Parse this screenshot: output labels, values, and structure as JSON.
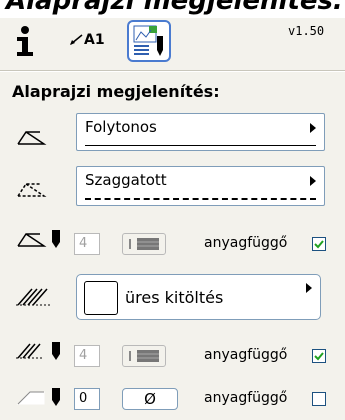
{
  "header": {
    "banner_title": "Alaprajzi megjelenítés:",
    "version": "v1.50",
    "info_icon": "info-icon",
    "arrow_label": "A1",
    "pen_button_icon": "pen-settings-icon"
  },
  "section": {
    "title": "Alaprajzi megjelenítés:"
  },
  "rows": {
    "solid_line": {
      "label": "Folytonos",
      "icon": "contour-line-icon"
    },
    "dashed_line": {
      "label": "Szaggatott",
      "icon": "dashed-line-icon"
    },
    "contour_pen": {
      "pen_value": "4",
      "checkbox_label": "anyagfüggő",
      "checked": true,
      "icon": "contour-pen-icon"
    },
    "fill": {
      "label": "üres kitöltés",
      "icon": "hatch-icon"
    },
    "fill_pen": {
      "pen_value": "4",
      "checkbox_label": "anyagfüggő",
      "checked": true,
      "icon": "hatch-pen-icon"
    },
    "background_pen": {
      "pen_value": "0",
      "null_symbol": "Ø",
      "checkbox_label": "anyagfüggő",
      "checked": false,
      "icon": "background-pen-icon"
    }
  },
  "colors": {
    "accent_border": "#4a7bd0",
    "checkbox_check": "#21a121",
    "panel_bg": "#f3f2ec"
  }
}
